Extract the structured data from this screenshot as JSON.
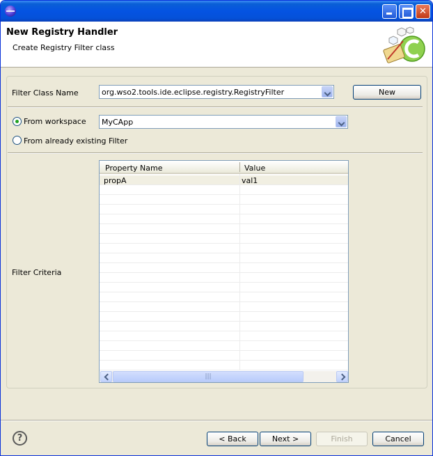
{
  "header": {
    "title": "New Registry Handler",
    "subtitle": "Create Registry Filter class"
  },
  "form": {
    "filter_class_label": "Filter Class Name",
    "filter_class_value": "org.wso2.tools.ide.eclipse.registry.RegistryFilter",
    "new_button": "New",
    "from_workspace_label": "From workspace",
    "workspace_value": "MyCApp",
    "from_existing_label": "From already existing Filter",
    "filter_criteria_label": "Filter Criteria"
  },
  "table": {
    "columns": [
      "Property Name",
      "Value"
    ],
    "rows": [
      {
        "name": "propA",
        "value": "val1"
      }
    ],
    "scroll_grip": "|||"
  },
  "footer": {
    "help": "?",
    "back": "< Back",
    "next": "Next >",
    "finish": "Finish",
    "cancel": "Cancel"
  }
}
